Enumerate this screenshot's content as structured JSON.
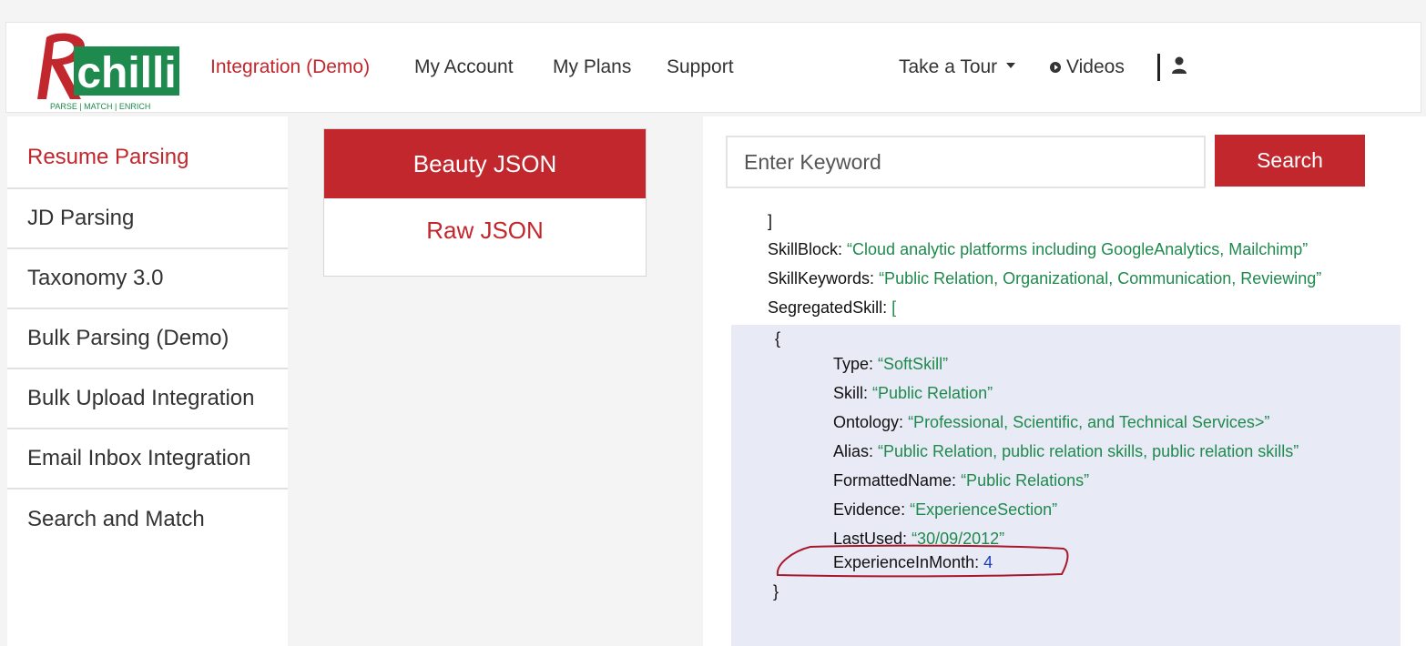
{
  "brand": {
    "logo_text": "chilli",
    "tagline": "PARSE | MATCH | ENRICH"
  },
  "nav": {
    "links": [
      "Integration (Demo)",
      "My Account",
      "My Plans",
      "Support"
    ],
    "tour": "Take a Tour",
    "videos": "Videos"
  },
  "sidebar": {
    "items": [
      {
        "label": "Resume Parsing"
      },
      {
        "label": "JD Parsing"
      },
      {
        "label": "Taxonomy 3.0"
      },
      {
        "label": "Bulk Parsing (Demo)"
      },
      {
        "label": "Bulk Upload Integration"
      },
      {
        "label": "Email Inbox Integration"
      },
      {
        "label": "Search and Match"
      }
    ]
  },
  "tabs": {
    "beauty": "Beauty JSON",
    "raw": "Raw JSON"
  },
  "search": {
    "placeholder": "Enter Keyword",
    "button": "Search"
  },
  "json": {
    "close_bracket": "]",
    "skill_block": {
      "key": "SkillBlock",
      "value": "“Cloud analytic platforms including GoogleAnalytics, Mailchimp”"
    },
    "skill_keywords": {
      "key": "SkillKeywords",
      "value": "“Public Relation, Organizational, Communication, Reviewing”"
    },
    "segregated": {
      "key": "SegregatedSkill",
      "value": "["
    },
    "open_brace": "{",
    "close_brace": "}",
    "fields": [
      {
        "key": "Type",
        "value": "“SoftSkill”"
      },
      {
        "key": "Skill",
        "value": "“Public Relation”"
      },
      {
        "key": "Ontology",
        "value": "“Professional, Scientific, and Technical Services>”"
      },
      {
        "key": "Alias",
        "value": "“Public Relation, public relation skills, public relation skills”"
      },
      {
        "key": "FormattedName",
        "value": "“Public Relations”"
      },
      {
        "key": "Evidence",
        "value": "“ExperienceSection”"
      },
      {
        "key": "LastUsed",
        "value": "“30/09/2012”"
      },
      {
        "key": "ExperienceInMonth",
        "value": "4"
      }
    ]
  },
  "colors": {
    "accent": "#c1272d",
    "value_green": "#1f8a4d",
    "number_blue": "#1a3fb5",
    "highlight": "#e8eaf6"
  }
}
